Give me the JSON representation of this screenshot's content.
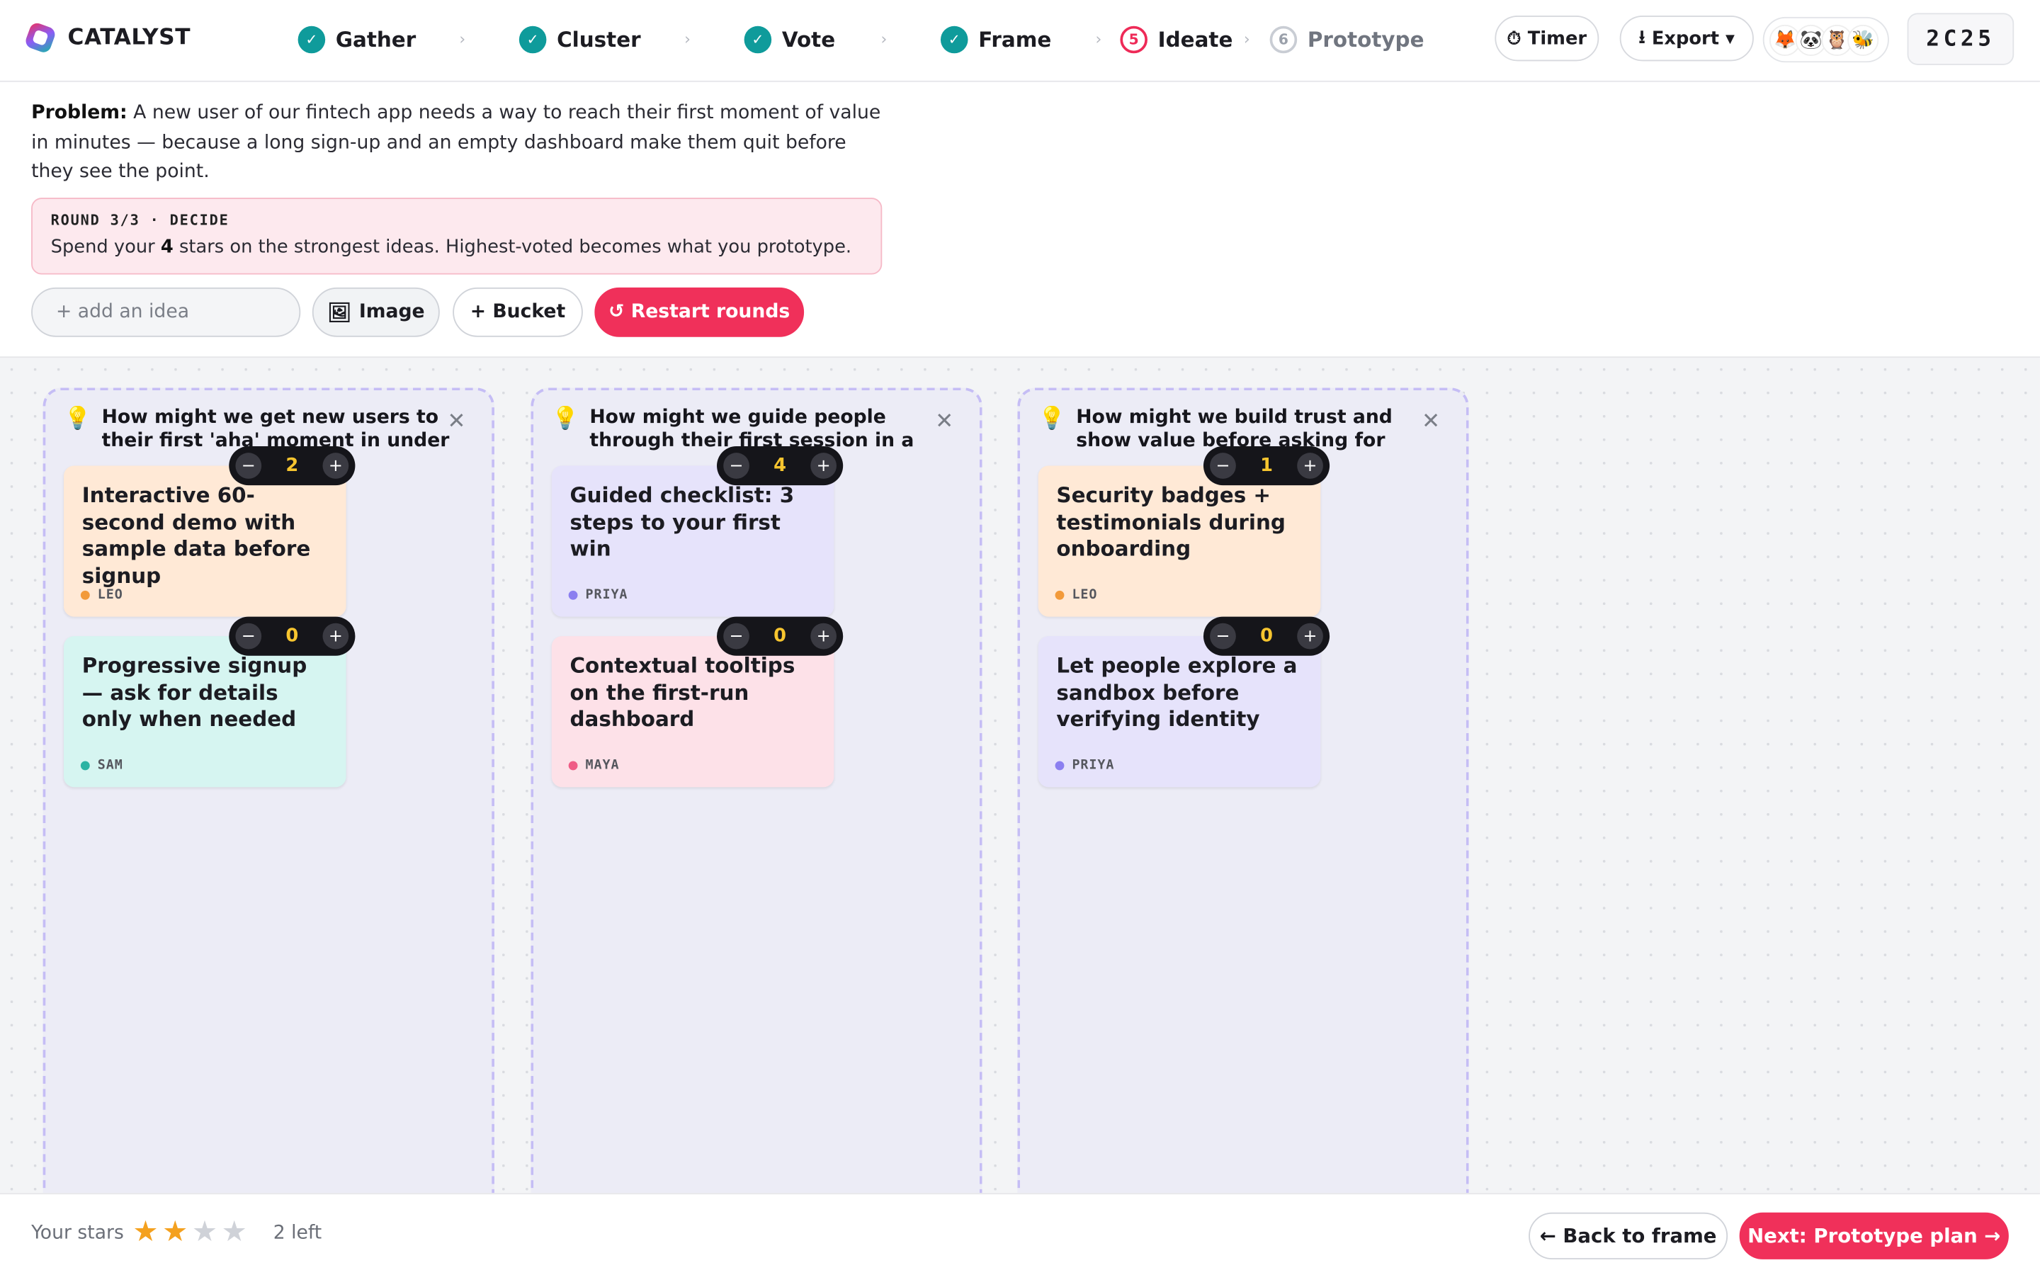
{
  "app": {
    "name": "CATALYST",
    "room_code": "2C25"
  },
  "steps": [
    {
      "num": "✓",
      "label": "Gather",
      "state": "done"
    },
    {
      "num": "✓",
      "label": "Cluster",
      "state": "done"
    },
    {
      "num": "✓",
      "label": "Vote",
      "state": "done"
    },
    {
      "num": "✓",
      "label": "Frame",
      "state": "done"
    },
    {
      "num": "5",
      "label": "Ideate",
      "state": "current"
    },
    {
      "num": "6",
      "label": "Prototype",
      "state": "future"
    }
  ],
  "header": {
    "timer_icon": "⏱",
    "timer_label": "Timer",
    "export_icon": "⭳",
    "export_label": "Export ▾",
    "avatars": [
      "🦊",
      "🐼",
      "🦉",
      "🐝"
    ]
  },
  "problem": {
    "label": "Problem:",
    "text": " A new user of our fintech app needs a way to reach their first moment of value in minutes — because a long sign-up and an empty dashboard make them quit before they see the point."
  },
  "round": {
    "title": "ROUND 3/3 · DECIDE",
    "text_before": "Spend your ",
    "stars": "4",
    "text_after": " stars on the strongest ideas. Highest-voted becomes what you prototype."
  },
  "toolbar": {
    "input_placeholder": "+ add an idea",
    "image_icon": "🖼",
    "image_label": "Image",
    "bucket_label": "+ Bucket",
    "restart_label": "↺ Restart rounds"
  },
  "buckets": [
    {
      "title": "How might we get new users to their first 'aha' moment in under a minute?",
      "cards": [
        {
          "text": "Interactive 60-second demo with sample data before signup",
          "author": "LEO",
          "votes": "2",
          "color": "#ffe9d6",
          "dot": "#f29a3a"
        },
        {
          "text": "Progressive signup — ask for details only when needed",
          "author": "SAM",
          "votes": "0",
          "color": "#d6f5f1",
          "dot": "#2bb3a3"
        }
      ]
    },
    {
      "title": "How might we guide people through their first session in a helpful way?",
      "cards": [
        {
          "text": "Guided checklist: 3 steps to your first win",
          "author": "PRIYA",
          "votes": "4",
          "color": "#e6e3fb",
          "dot": "#8b7ff0"
        },
        {
          "text": "Contextual tooltips on the first-run dashboard",
          "author": "MAYA",
          "votes": "0",
          "color": "#fde1e8",
          "dot": "#ef5c86"
        }
      ]
    },
    {
      "title": "How might we build trust and show value before asking for sensitive info?",
      "cards": [
        {
          "text": "Security badges + testimonials during onboarding",
          "author": "LEO",
          "votes": "1",
          "color": "#ffe9d6",
          "dot": "#f29a3a"
        },
        {
          "text": "Let people explore a sandbox before verifying identity",
          "author": "PRIYA",
          "votes": "0",
          "color": "#e6e3fb",
          "dot": "#8b7ff0"
        }
      ]
    }
  ],
  "footer": {
    "stars_label": "Your stars",
    "stars_used": 2,
    "stars_total": 4,
    "stars_left": "2 left",
    "back_label": "← Back to frame",
    "next_label": "Next: Prototype plan →"
  },
  "colors": {
    "accent": "#f0305a",
    "done": "#0f9b9b",
    "bucket_border": "#c5bdf5"
  }
}
